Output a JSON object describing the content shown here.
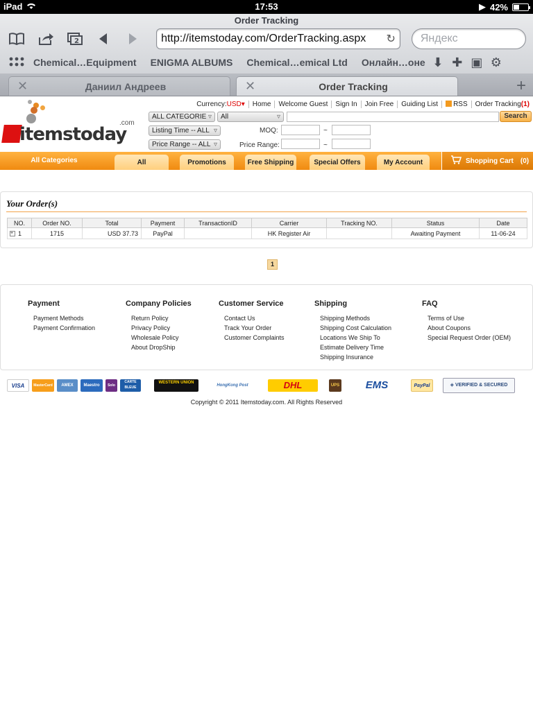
{
  "status_bar": {
    "device": "iPad",
    "time": "17:53",
    "battery": "42%",
    "battery_level": 0.42
  },
  "browser": {
    "page_title": "Order Tracking",
    "url": "http://itemstoday.com/OrderTracking.aspx",
    "search_placeholder": "Яндекс",
    "bookmarks": [
      "Chemical…Equipment",
      "ENIGMA ALBUMS",
      "Chemical…emical Ltd",
      "Онлайн…оне"
    ],
    "tabs": [
      {
        "label": "Даниил Андреев",
        "active": false
      },
      {
        "label": "Order Tracking",
        "active": true
      }
    ]
  },
  "site": {
    "logo": {
      "word": "itemstoday",
      "com": ".com"
    },
    "topnav": {
      "currency_label": "Currency:",
      "currency_value": "USD",
      "home": "Home",
      "welcome": "Welcome Guest",
      "sign_in": "Sign In",
      "join": "Join Free",
      "guiding": "Guiding List",
      "rss": "RSS",
      "tracking": "Order Tracking",
      "tracking_count": "(1)"
    },
    "filters": {
      "category": "ALL CATEGORIE",
      "scope": "All",
      "search_button": "Search",
      "listing_time": "Listing Time -- ALL",
      "moq_label": "MOQ:",
      "price_range_select": "Price Range -- ALL",
      "price_range_label": "Price Range:",
      "range_sep": "~"
    },
    "nav": {
      "all_categories": "All Categories",
      "tabs": [
        "All",
        "Promotions",
        "Free Shipping",
        "Special Offers",
        "My Account"
      ],
      "cart": "Shopping Cart",
      "cart_count": "(0)"
    }
  },
  "orders": {
    "title": "Your Order(s)",
    "columns": [
      "NO.",
      "Order NO.",
      "Total",
      "Payment",
      "TransactionID",
      "Carrier",
      "Tracking NO.",
      "Status",
      "Date"
    ],
    "rows": [
      [
        "1",
        "1715",
        "USD 37.73",
        "PayPal",
        "",
        "HK Register Air",
        "",
        "Awaiting Payment",
        "11-06-24"
      ]
    ],
    "page": "1"
  },
  "footer": {
    "columns": [
      {
        "heading": "Payment",
        "items": [
          "Payment Methods",
          "Payment Confirmation"
        ]
      },
      {
        "heading": "Company Policies",
        "items": [
          "Return Policy",
          "Privacy Policy",
          "Wholesale Policy",
          "About DropShip"
        ]
      },
      {
        "heading": "Customer Service",
        "items": [
          "Contact Us",
          "Track Your Order",
          "Customer Complaints"
        ]
      },
      {
        "heading": "Shipping",
        "items": [
          "Shipping Methods",
          "Shipping Cost Calculation",
          "Locations We Ship To",
          "Estimate Delivery Time",
          "Shipping Insurance"
        ]
      },
      {
        "heading": "FAQ",
        "items": [
          "Terms of Use",
          "About Coupons",
          "Special Request Order (OEM)"
        ]
      }
    ],
    "payment_logos": [
      "VISA",
      "MasterCard",
      "AMEX",
      "Maestro",
      "Solo",
      "CARTE BLEUE",
      "WESTERN UNION",
      "HongKong Post",
      "DHL",
      "UPS",
      "EMS",
      "PayPal",
      "VERIFIED & SECURED"
    ],
    "copyright": "Copyright © 2011 Itemstoday.com. All Rights Reserved"
  },
  "colors": {
    "brand_orange": "#f08a10",
    "logo_red": "#dd1111",
    "rule_orange": "#f3a34a"
  }
}
